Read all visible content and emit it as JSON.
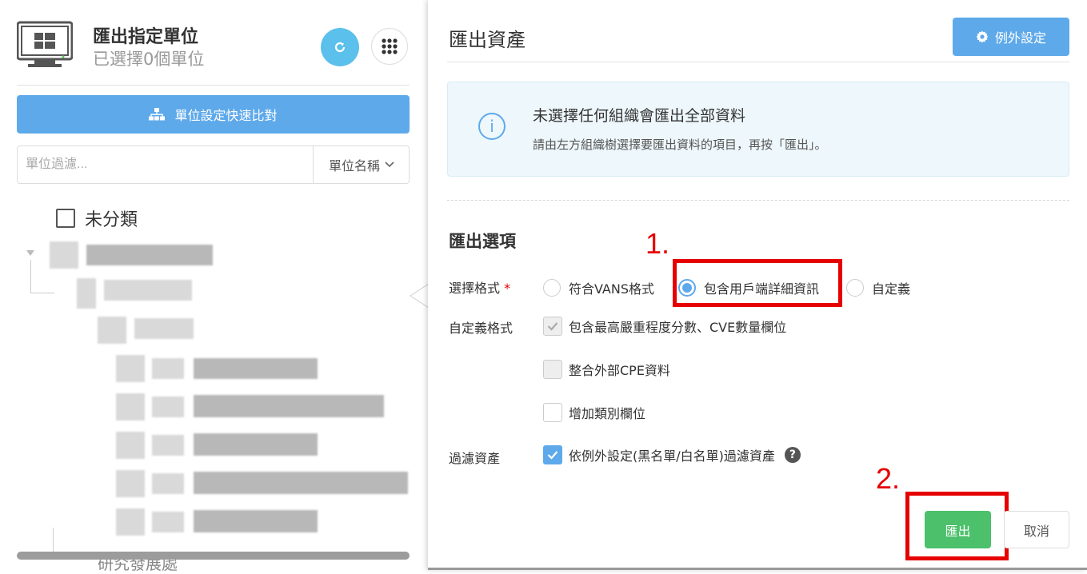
{
  "left": {
    "title": "匯出指定單位",
    "subtitle": "已選擇0個單位",
    "refresh_icon": "refresh-icon",
    "grid_icon": "grid-menu-icon",
    "compare_button": "單位設定快速比對",
    "filter_placeholder": "單位過濾...",
    "filter_select": "單位名稱",
    "tree_root": "未分類",
    "partial_item": "研究發展處"
  },
  "dialog": {
    "title": "匯出資產",
    "exception_button": "例外設定",
    "info_title": "未選擇任何組織會匯出全部資料",
    "info_desc": "請由左方組織樹選擇要匯出資料的項目，再按「匯出」。",
    "section_title": "匯出選項",
    "format_label": "選擇格式",
    "required_mark": "*",
    "format_options": [
      "符合VANS格式",
      "包含用戶端詳細資訊",
      "自定義"
    ],
    "selected_format": "包含用戶端詳細資訊",
    "custom_label": "自定義格式",
    "custom_options": [
      "包含最高嚴重程度分數、CVE數量欄位",
      "整合外部CPE資料",
      "增加類別欄位"
    ],
    "filter_label": "過濾資產",
    "filter_option": "依例外設定(黑名單/白名單)過濾資產",
    "export_button": "匯出",
    "cancel_button": "取消"
  },
  "annotations": {
    "step1": "1.",
    "step2": "2."
  },
  "colors": {
    "accent": "#5ea9ea",
    "success": "#4cc06b",
    "annotation": "#e60000"
  }
}
